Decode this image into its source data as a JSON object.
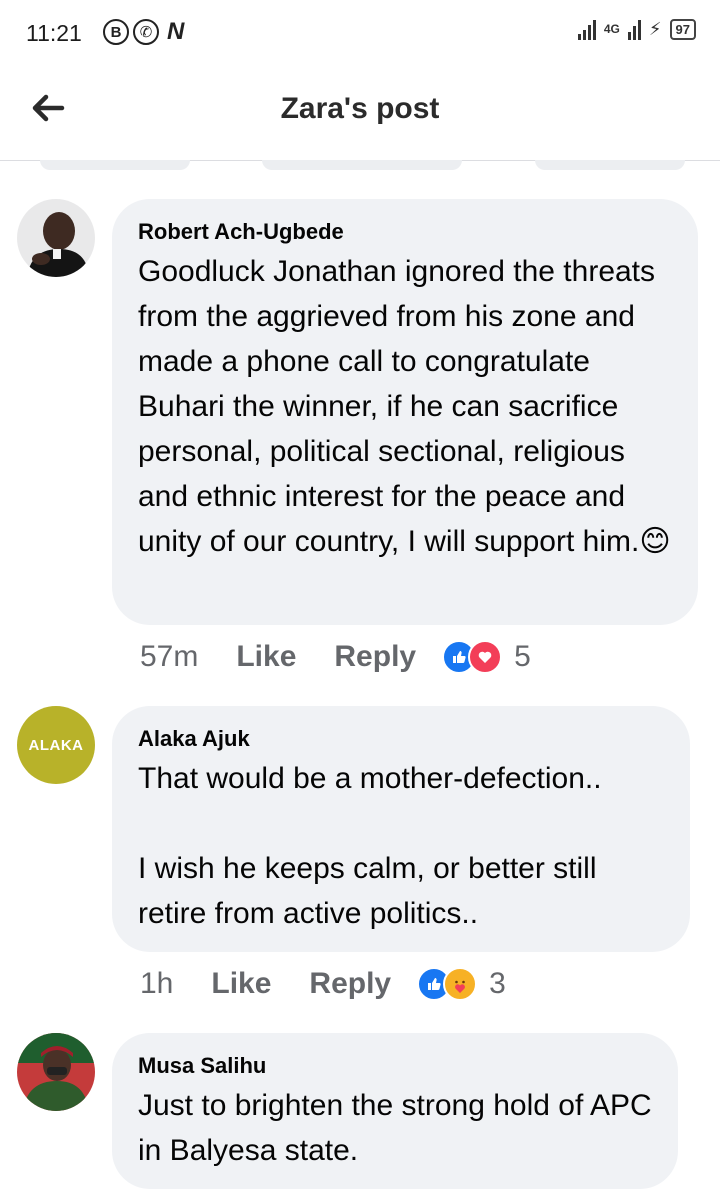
{
  "status_bar": {
    "time": "11:21",
    "icons": [
      "b-icon",
      "whatsapp-icon",
      "n-icon"
    ],
    "network": "4G",
    "battery": "97"
  },
  "header": {
    "title": "Zara's post"
  },
  "comments": [
    {
      "author": "Robert Ach-Ugbede",
      "text": "Goodluck Jonathan ignored the threats from the aggrieved from his zone and made a phone call to congratulate Buhari the winner, if he can sacrifice personal, political sectional, religious and ethnic interest for the peace and unity of our country, I will support him.",
      "emoji": "😊",
      "time": "57m",
      "like": "Like",
      "reply": "Reply",
      "reactions": [
        "like-icon",
        "love-icon"
      ],
      "reaction_count": "5"
    },
    {
      "author": "Alaka Ajuk",
      "avatar_text": "ALAKA",
      "text": "That would be a mother-defection..\n\nI wish he keeps calm, or better still retire from active politics..",
      "time": "1h",
      "like": "Like",
      "reply": "Reply",
      "reactions": [
        "like-icon",
        "care-icon"
      ],
      "reaction_count": "3"
    },
    {
      "author": "Musa Salihu",
      "text": "Just to brighten the strong hold of APC in Balyesa state."
    }
  ],
  "colors": {
    "bubble": "#f0f2f5",
    "like_blue": "#1877f2",
    "love_red": "#f33e58",
    "care_yellow": "#f7b125",
    "alaka_avatar": "#b8b229",
    "meta_gray": "#65676b"
  }
}
